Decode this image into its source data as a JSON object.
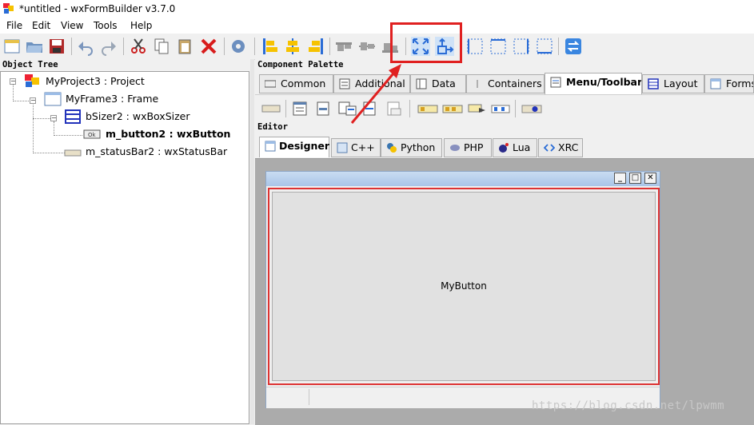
{
  "window": {
    "title": "*untitled - wxFormBuilder v3.7.0"
  },
  "menu": [
    "File",
    "Edit",
    "View",
    "Tools",
    "Help"
  ],
  "toolbar": {
    "buttons": [
      "new-file-icon",
      "open-folder-icon",
      "save-icon",
      "undo-icon",
      "redo-icon",
      "cut-icon",
      "copy-icon",
      "paste-icon",
      "delete-icon",
      "generate-code-icon",
      "align-left-icon",
      "align-center-h-icon",
      "align-right-icon",
      "align-top-icon",
      "align-center-v-icon",
      "align-bottom-icon",
      "expand-icon",
      "stretch-icon",
      "border-left-icon",
      "border-right-icon",
      "border-top-icon",
      "border-bottom-icon",
      "toggle-orientation-icon"
    ]
  },
  "object_tree": {
    "header": "Object Tree",
    "items": [
      {
        "label": "MyProject3 : Project",
        "bold": false
      },
      {
        "label": "MyFrame3 : Frame",
        "bold": false
      },
      {
        "label": "bSizer2 : wxBoxSizer",
        "bold": false
      },
      {
        "label": "m_button2 : wxButton",
        "bold": true
      },
      {
        "label": "m_statusBar2 : wxStatusBar",
        "bold": false
      }
    ]
  },
  "palette": {
    "header": "Component Palette",
    "tabs": [
      "Common",
      "Additional",
      "Data",
      "Containers",
      "Menu/Toolbar",
      "Layout",
      "Forms"
    ],
    "active_tab": "Menu/Toolbar"
  },
  "editor": {
    "header": "Editor",
    "tabs": [
      "Designer",
      "C++",
      "Python",
      "PHP",
      "Lua",
      "XRC"
    ],
    "active_tab": "Designer"
  },
  "design_frame": {
    "button_label": "MyButton"
  },
  "watermark": "https://blog.csdn.net/lpwmm",
  "colors": {
    "highlight": "#e02020",
    "selection_border": "#d33333",
    "frame_title": "#b8d0ee"
  }
}
